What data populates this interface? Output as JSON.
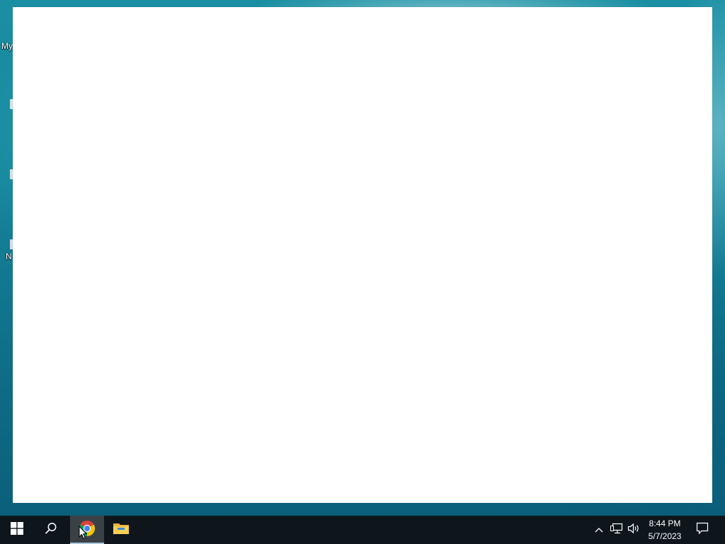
{
  "desktop": {
    "icons": [
      {
        "label": "My"
      },
      {
        "label": ""
      },
      {
        "label": ""
      },
      {
        "label": "N"
      }
    ]
  },
  "window": {
    "content": ""
  },
  "taskbar": {
    "start_icon": "windows-logo-icon",
    "search_icon": "search-icon",
    "pinned": [
      {
        "name": "Google Chrome",
        "icon": "chrome-icon",
        "active": true
      },
      {
        "name": "File Explorer",
        "icon": "folder-icon",
        "active": false
      }
    ],
    "tray": {
      "chevron_icon": "chevron-up-icon",
      "network_icon": "network-icon",
      "volume_icon": "volume-icon",
      "time": "8:44 PM",
      "date": "5/7/2023",
      "notification_icon": "notification-icon"
    }
  },
  "colors": {
    "taskbar_bg": "#0e161b",
    "active_app_bg": "#3a4146",
    "active_indicator": "#a9c7de",
    "window_bg": "#ffffff"
  }
}
